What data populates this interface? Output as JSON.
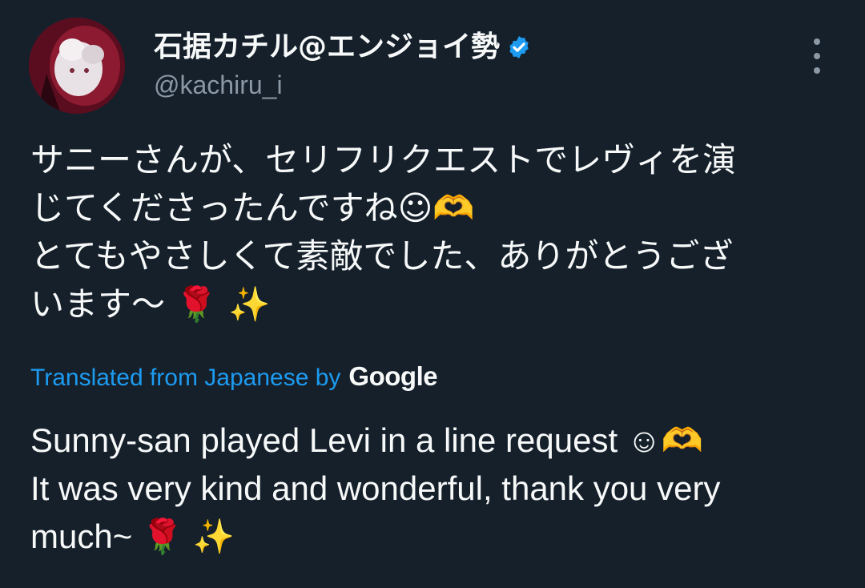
{
  "author": {
    "display_name": "石据カチル@エンジョイ勢",
    "handle": "@kachiru_i",
    "verified": true,
    "verified_color": "#1d9bf0",
    "avatar_icon": "avatar-photo"
  },
  "menu": {
    "icon": "more-vertical-icon"
  },
  "tweet": {
    "lines": [
      "サニーさんが、セリフリクエストでレヴィを演",
      "じてくださったんですね☺🫶",
      "とてもやさしくて素敵でした、ありがとうござ",
      "います～ 🌹 ✨"
    ]
  },
  "translation_bar": {
    "label": "Translated from Japanese by",
    "provider": "Google",
    "link_color": "#1d9bf0"
  },
  "translation": {
    "lines": [
      "Sunny-san played Levi in a line request ☺🫶",
      "It was very kind and wonderful, thank you very",
      "much~ 🌹 ✨"
    ]
  },
  "colors": {
    "background": "#15202b",
    "text": "#f7f9f9",
    "secondary": "#8b98a5"
  }
}
